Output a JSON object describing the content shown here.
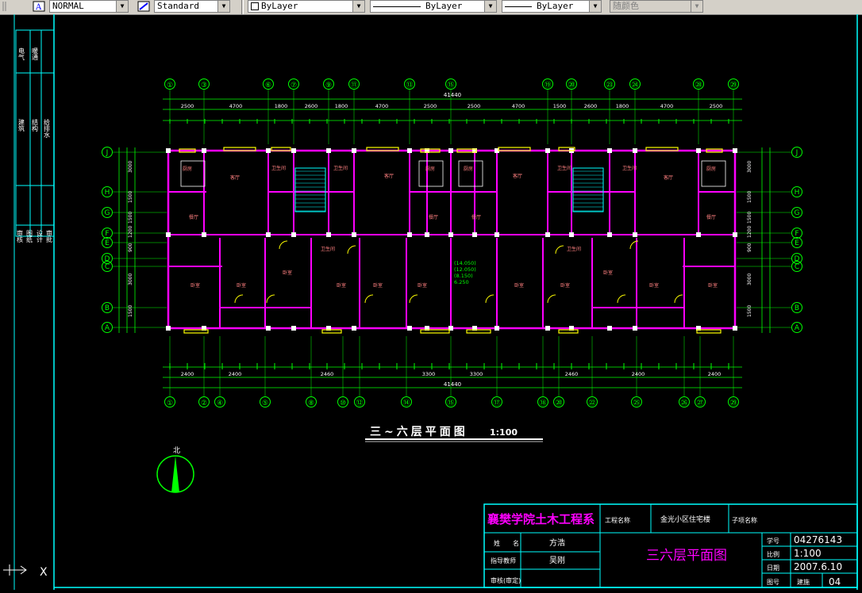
{
  "toolbar": {
    "text_style": "NORMAL",
    "dim_style": "Standard",
    "layer": "ByLayer",
    "linetype": "ByLayer",
    "lineweight": "ByLayer",
    "plot_style": "随颜色"
  },
  "drawing": {
    "title": "三~六层平面图",
    "scale": "1:100",
    "north_label": "北",
    "overall_dim": "41440",
    "top_axes": [
      "①",
      "③",
      "⑥",
      "⑦",
      "⑨",
      "⑪",
      "⑬",
      "⑮",
      "⑲",
      "⑳",
      "㉓",
      "㉔",
      "㉘",
      "㉙"
    ],
    "bottom_axes": [
      "①",
      "②",
      "④",
      "⑤",
      "⑧",
      "⑩",
      "⑫",
      "⑭",
      "⑮",
      "⑰",
      "⑱",
      "⑳",
      "㉒",
      "㉕",
      "㉖",
      "㉗",
      "㉙"
    ],
    "left_axes": [
      "J",
      "H",
      "G",
      "F",
      "E",
      "D",
      "C",
      "B",
      "A"
    ],
    "top_dims_row1": [
      "2500",
      "4700",
      "1800",
      "2600",
      "1800",
      "4700",
      "2500",
      "2500",
      "4700",
      "1500",
      "2600",
      "1800",
      "4700",
      "2500"
    ],
    "bottom_dims_row1": [
      "2400",
      "2400",
      "2460",
      "3300",
      "3300",
      "2460",
      "2400",
      "2400"
    ],
    "left_dims": [
      "3000",
      "1500",
      "1500",
      "1200",
      "900",
      "3000",
      "1500"
    ],
    "rooms": {
      "bedroom": "卧室",
      "living": "客厅",
      "dining": "餐厅",
      "bath": "卫生间",
      "kitchen": "厨房",
      "balcony": "阳台"
    },
    "elevations": [
      "(14.050)",
      "(12.050)",
      "(8.150)",
      "6.250"
    ],
    "side_labels_top": [
      "电气",
      "暖通"
    ],
    "side_labels_mid": [
      "建筑",
      "结构",
      "给排水"
    ],
    "side_labels_bot": [
      "审核",
      "图纸",
      "设计",
      "审批"
    ]
  },
  "title_block": {
    "school": "襄樊学院土木工程系",
    "project_label": "工程名称",
    "project_name": "金光小区住宅楼",
    "sheet_label": "子项名称",
    "name_label": "姓　　名",
    "name_value": "方浩",
    "advisor_label": "指导教师",
    "advisor_value": "吴刚",
    "reviewer_label": "审核(审定)",
    "drawing_title": "三六层平面图",
    "no_label": "学号",
    "no_value": "04276143",
    "scale_label": "比例",
    "scale_value": "1:100",
    "date_label": "日期",
    "date_value": "2007.6.10",
    "sheet_no_label": "图号",
    "sheet_no_label2": "建施",
    "sheet_no_value": "04"
  },
  "ucs": {
    "x_label": "X"
  },
  "colors": {
    "background": "#000000",
    "walls": "#ff00ff",
    "dims": "#00ff00",
    "border": "#00ffff",
    "windows": "#ffff00"
  }
}
